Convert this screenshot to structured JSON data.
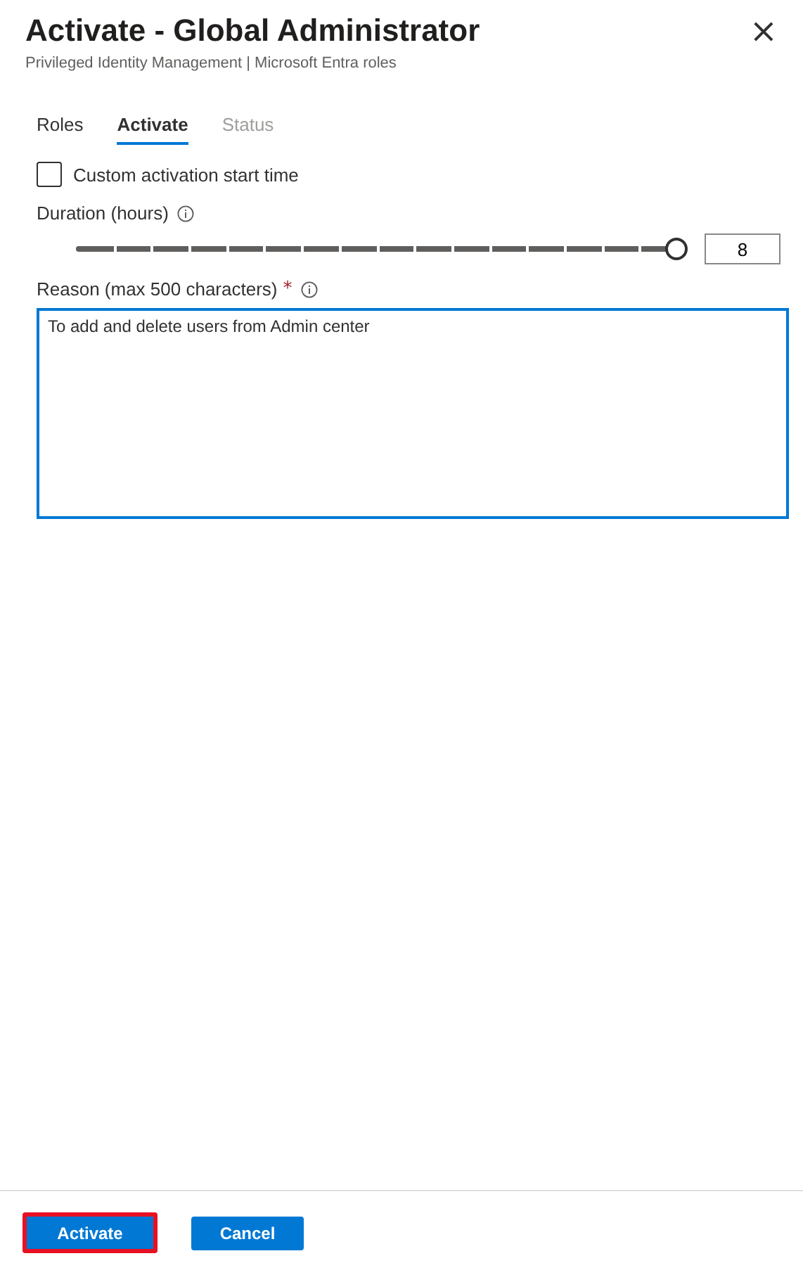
{
  "header": {
    "title": "Activate - Global Administrator",
    "subtitle": "Privileged Identity Management | Microsoft Entra roles",
    "close": "×"
  },
  "tabs": [
    {
      "label": "Roles",
      "selected": false,
      "disabled": false
    },
    {
      "label": "Activate",
      "selected": true,
      "disabled": false
    },
    {
      "label": "Status",
      "selected": false,
      "disabled": true
    }
  ],
  "custom_start": {
    "label": "Custom activation start time",
    "checked": false
  },
  "duration": {
    "label": "Duration (hours)",
    "level": 1,
    "value": "8"
  },
  "reason": {
    "label": "Reason (max 500 characters)",
    "required_mark": "*",
    "value": "To add and delete users from Admin center"
  },
  "buttons": [
    {
      "label": "Activate",
      "highlighted": true
    },
    {
      "label": "Cancel",
      "highlighted": false
    }
  ]
}
